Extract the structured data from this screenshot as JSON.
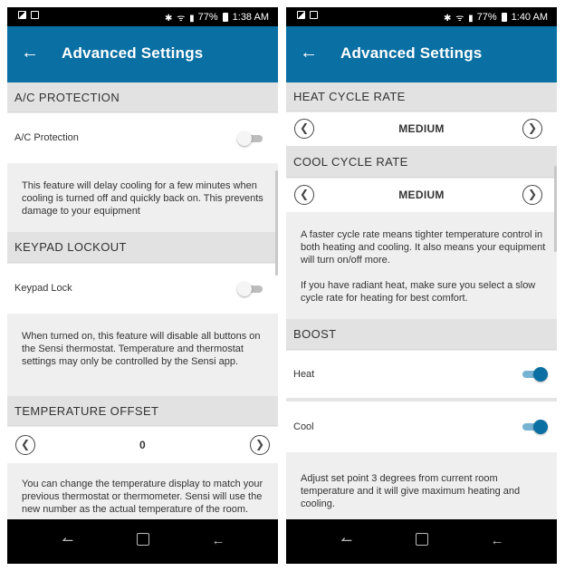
{
  "left": {
    "status": {
      "battery": "77%",
      "time": "1:38 AM"
    },
    "app_bar": {
      "title": "Advanced Settings"
    },
    "ac_protection": {
      "header": "A/C PROTECTION",
      "label": "A/C Protection",
      "enabled": false,
      "description": "This feature will delay cooling for a few minutes when cooling is turned off and quickly back on. This prevents damage to your equipment"
    },
    "keypad_lockout": {
      "header": "KEYPAD LOCKOUT",
      "label": "Keypad Lock",
      "enabled": false,
      "description": "When turned on, this feature will disable all buttons on the Sensi thermostat. Temperature and thermostat settings may only be controlled by the Sensi app."
    },
    "temperature_offset": {
      "header": "TEMPERATURE OFFSET",
      "value": "0",
      "description": "You can change the temperature display to match your previous thermostat or thermometer. Sensi will use the new number as the actual temperature of the room."
    }
  },
  "right": {
    "status": {
      "battery": "77%",
      "time": "1:40 AM"
    },
    "app_bar": {
      "title": "Advanced Settings"
    },
    "heat_cycle": {
      "header": "HEAT CYCLE RATE",
      "value": "MEDIUM"
    },
    "cool_cycle": {
      "header": "COOL CYCLE RATE",
      "value": "MEDIUM"
    },
    "cycle_description": {
      "p1": "A faster cycle rate means tighter temperature control in both heating and cooling. It also means your equipment will turn on/off more.",
      "p2": "If you have radiant heat, make sure you select a slow cycle rate for heating for best comfort."
    },
    "boost": {
      "header": "BOOST",
      "heat_label": "Heat",
      "heat_enabled": true,
      "cool_label": "Cool",
      "cool_enabled": true,
      "description": "Adjust set point 3 degrees from current room temperature and it will give maximum heating and cooling."
    }
  },
  "icons": {
    "back": "arrow-left-icon",
    "prev": "chevron-left-icon",
    "next": "chevron-right-icon",
    "nav_recent": "recent-apps-icon",
    "nav_home": "home-icon",
    "nav_back": "nav-back-icon"
  },
  "colors": {
    "brand": "#0a6fa3",
    "toggle_on_track": "#76b3d3",
    "section_bg": "#e2e2e2"
  }
}
